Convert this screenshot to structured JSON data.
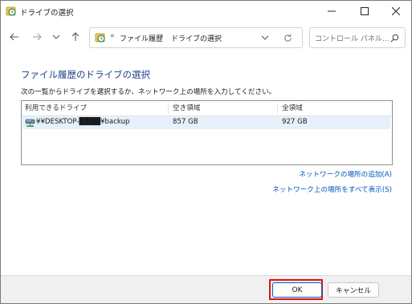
{
  "window": {
    "title": "ドライブの選択"
  },
  "nav": {
    "back": "←",
    "forward": "→",
    "recent": "⌄",
    "up": "↑"
  },
  "address": {
    "chevron": "«",
    "segment1": "ファイル履歴",
    "separator": "›",
    "segment2": "ドライブの選択"
  },
  "search": {
    "placeholder": "コントロール パネル..."
  },
  "content": {
    "heading": "ファイル履歴のドライブの選択",
    "instruction": "次の一覧からドライブを選択するか、ネットワーク上の場所を入力してください。"
  },
  "drives": {
    "columns": [
      "利用できるドライブ",
      "空き領域",
      "全領域"
    ],
    "rows": [
      {
        "path": "¥¥DESKTOP-████¥backup",
        "free": "857 GB",
        "total": "927 GB"
      }
    ]
  },
  "links": {
    "add_network": "ネットワークの場所の追加(A)",
    "show_all": "ネットワーク上の場所をすべて表示(S)"
  },
  "buttons": {
    "ok": "OK",
    "cancel": "キャンセル"
  },
  "colors": {
    "heading": "#1e3f8c",
    "link": "#0055b8",
    "selection": "#e5f0fb",
    "highlight_box": "#e0101c"
  }
}
